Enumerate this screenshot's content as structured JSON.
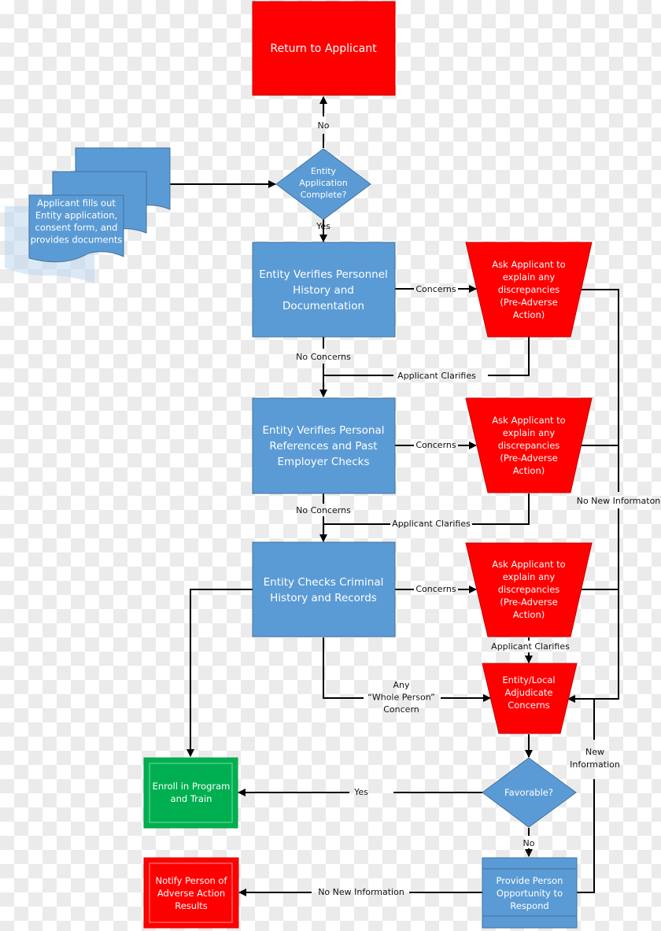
{
  "colors": {
    "process_blue": "#5b9bd5",
    "process_blue_border": "#41719c",
    "alert_red": "#ff0000",
    "success_green": "#00b050",
    "line": "#000000",
    "doc_shadow": "#bdd7ee"
  },
  "nodes": {
    "applicant_docs": "Applicant fills out\nEntity application,\nconsent form, and\nprovides documents",
    "return_to_applicant": "Return to Applicant",
    "application_complete": "Entity\nApplication\nComplete?",
    "verify_personnel": "Entity Verifies Personnel\nHistory and\nDocumentation",
    "verify_references": "Entity Verifies Personal\nReferences and Past\nEmployer Checks",
    "check_criminal": "Entity Checks Criminal\nHistory and Records",
    "ask_applicant_1": "Ask Applicant to\nexplain any\ndiscrepancies\n(Pre-Adverse\nAction)",
    "ask_applicant_2": "Ask Applicant to\nexplain any\ndiscrepancies\n(Pre-Adverse\nAction)",
    "ask_applicant_3": "Ask Applicant to\nexplain any\ndiscrepancies\n(Pre-Adverse\nAction)",
    "adjudicate": "Entity/Local\nAdjudicate\nConcerns",
    "favorable": "Favorable?",
    "enroll": "Enroll in Program\nand Train",
    "provide_opportunity": "Provide Person\nOpportunity to\nRespond",
    "notify_adverse": "Notify Person of\nAdverse Action\nResults"
  },
  "edge_labels": {
    "no_return": "No",
    "yes_complete": "Yes",
    "concerns_1": "Concerns",
    "concerns_2": "Concerns",
    "concerns_3": "Concerns",
    "no_concerns_1": "No Concerns",
    "no_concerns_2": "No Concerns",
    "clarifies_1": "Applicant Clarifies",
    "clarifies_2": "Applicant Clarifies",
    "clarifies_3": "Applicant Clarifies",
    "no_new_info_side": "No New Informaton",
    "whole_person": "Any\n“Whole Person”\nConcern",
    "new_information": "New\nInformation",
    "yes_favorable": "Yes",
    "no_favorable": "No",
    "no_new_info_bottom": "No New Information"
  }
}
